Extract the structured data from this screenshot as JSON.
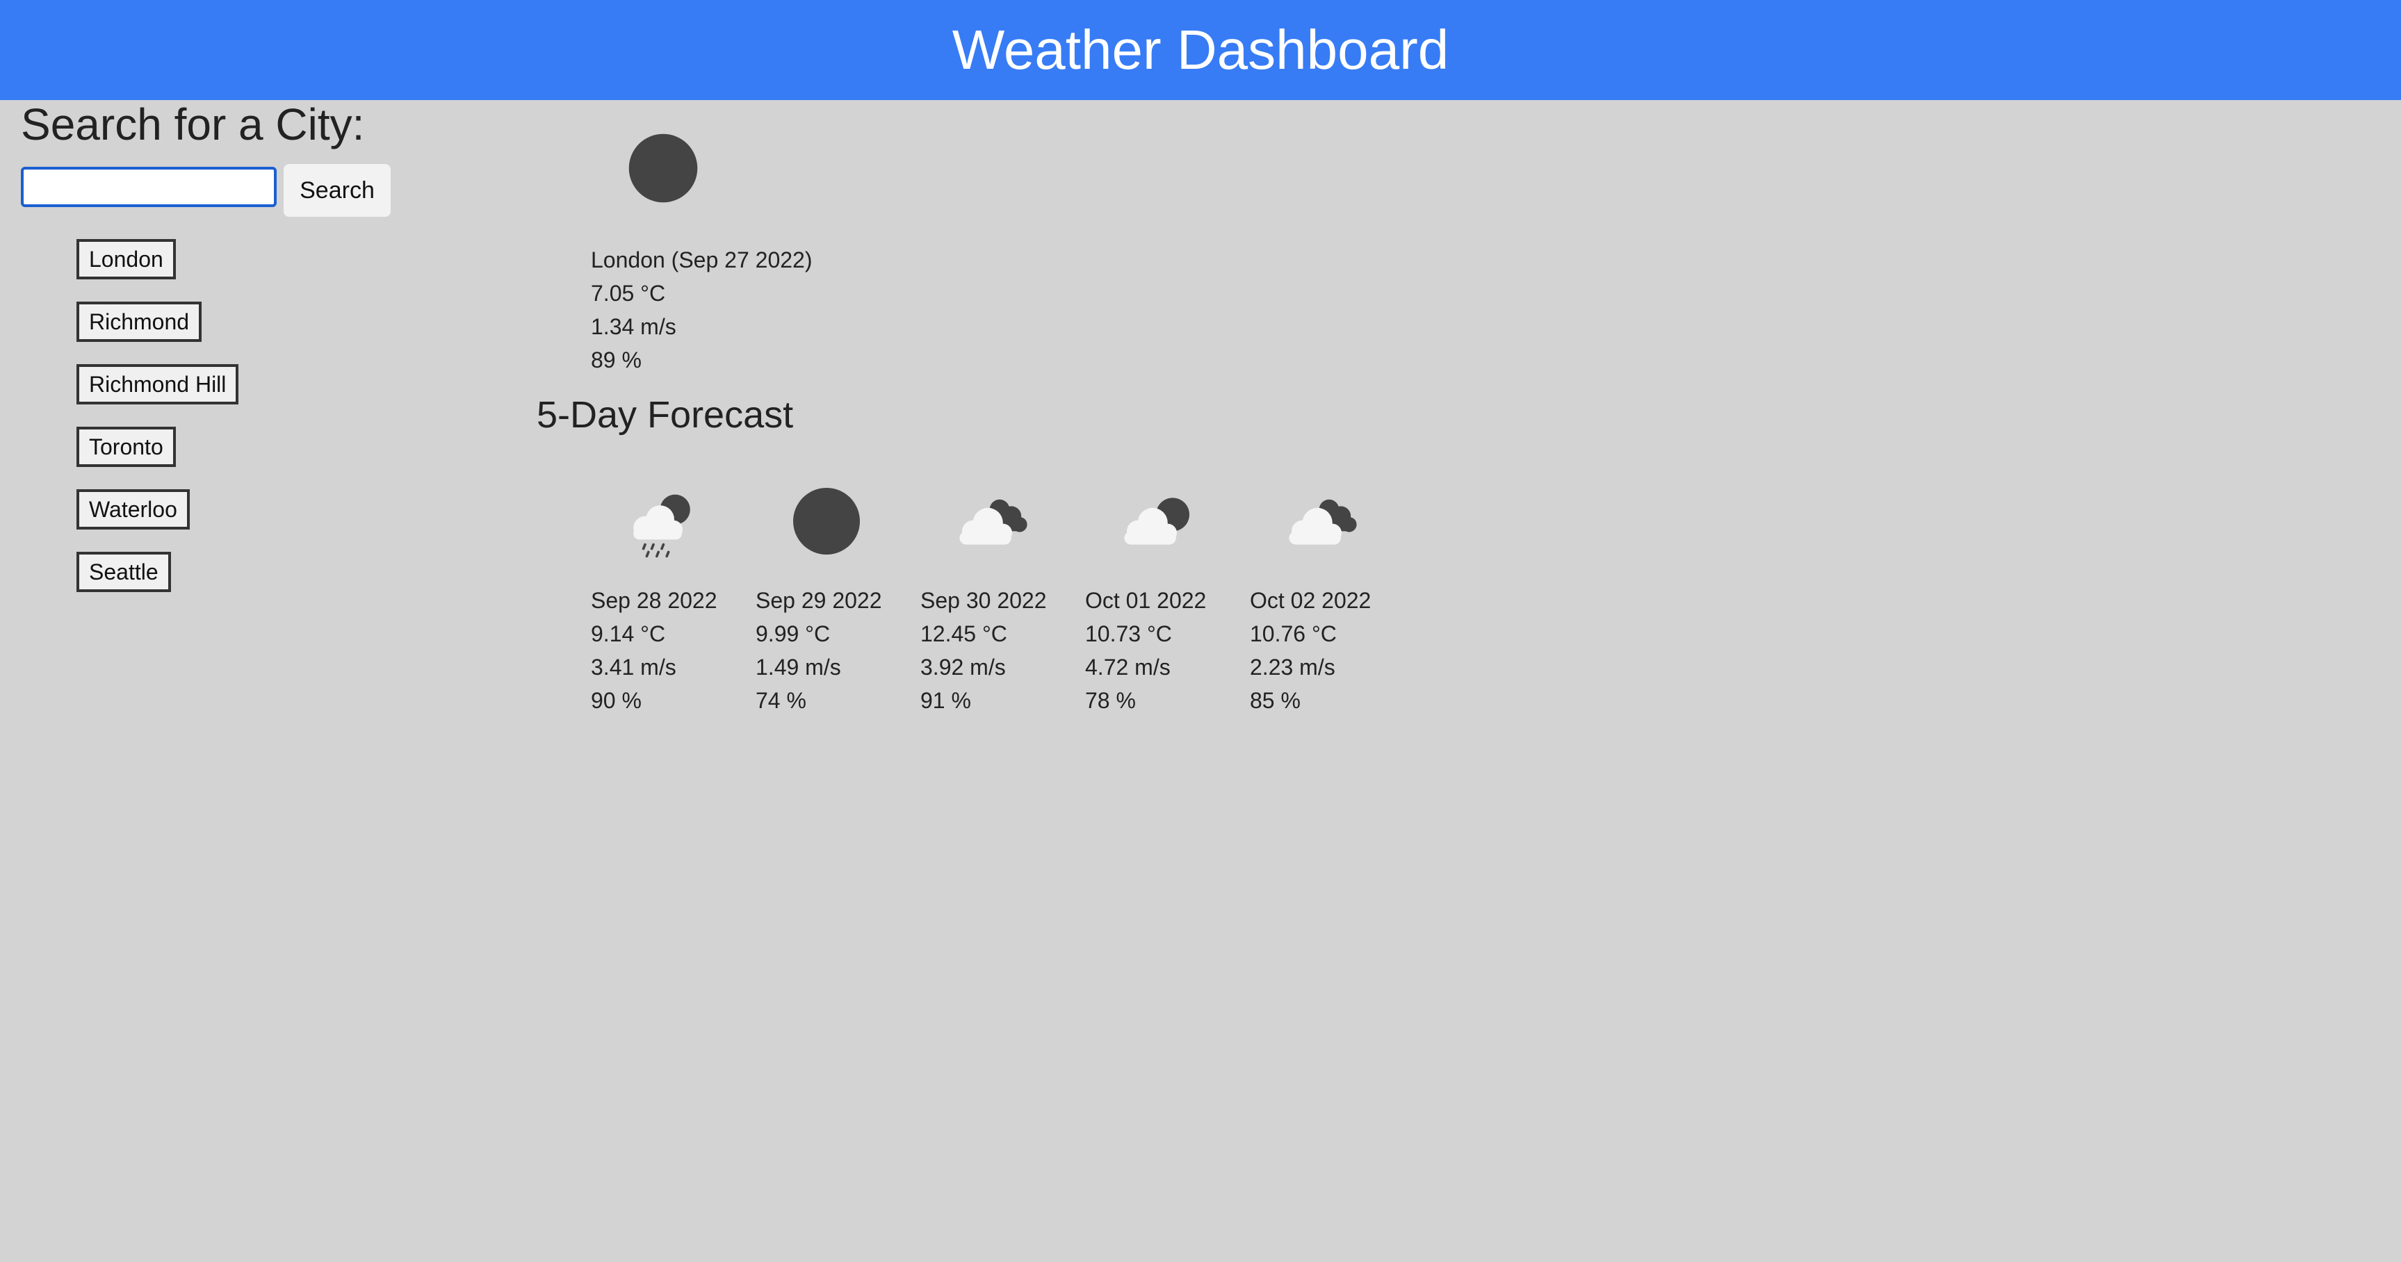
{
  "header": {
    "title": "Weather Dashboard"
  },
  "search": {
    "heading": "Search for a City:",
    "value": "",
    "button_label": "Search"
  },
  "history": [
    "London",
    "Richmond",
    "Richmond Hill",
    "Toronto",
    "Waterloo",
    "Seattle"
  ],
  "current": {
    "icon": "clear-night-icon",
    "title": "London (Sep 27 2022)",
    "temperature": "7.05 °C",
    "wind": "1.34 m/s",
    "humidity": "89 %"
  },
  "forecast": {
    "heading": "5-Day Forecast",
    "days": [
      {
        "icon": "rain-night-icon",
        "date": "Sep 28 2022",
        "temperature": "9.14 °C",
        "wind": "3.41 m/s",
        "humidity": "90 %"
      },
      {
        "icon": "clear-night-icon",
        "date": "Sep 29 2022",
        "temperature": "9.99 °C",
        "wind": "1.49 m/s",
        "humidity": "74 %"
      },
      {
        "icon": "broken-clouds-icon",
        "date": "Sep 30 2022",
        "temperature": "12.45 °C",
        "wind": "3.92 m/s",
        "humidity": "91 %"
      },
      {
        "icon": "partly-cloudy-night-icon",
        "date": "Oct 01 2022",
        "temperature": "10.73 °C",
        "wind": "4.72 m/s",
        "humidity": "78 %"
      },
      {
        "icon": "broken-clouds-icon",
        "date": "Oct 02 2022",
        "temperature": "10.76 °C",
        "wind": "2.23 m/s",
        "humidity": "85 %"
      }
    ]
  },
  "colors": {
    "header": "#377cf5",
    "background": "#d3d3d3",
    "icon_dark": "#444444",
    "icon_cloud": "#f5f5f5"
  }
}
